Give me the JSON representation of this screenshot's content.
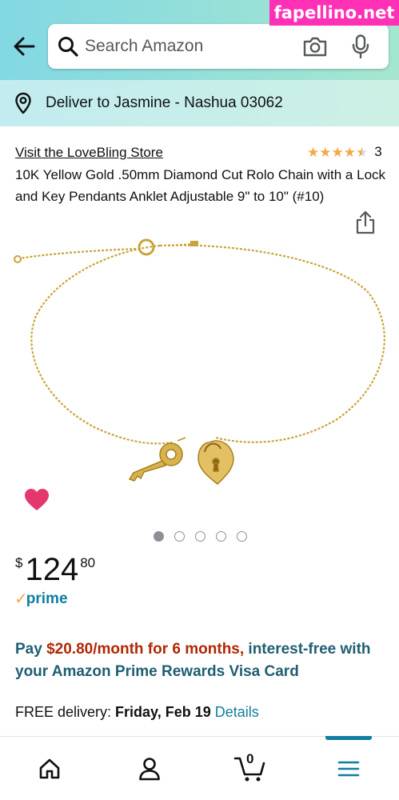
{
  "watermark": "fapellino.net",
  "search": {
    "placeholder": "Search Amazon"
  },
  "delivery_bar": {
    "text": "Deliver to Jasmine - Nashua 03062"
  },
  "product": {
    "store_link": "Visit the LoveBling Store",
    "rating_value": 4.5,
    "rating_count": "3",
    "title": "10K Yellow Gold .50mm Diamond Cut Rolo Chain with a Lock and Key Pendants Anklet Adjustable 9\" to 10\" (#10)",
    "image_count": 5,
    "active_image": 1
  },
  "price": {
    "currency": "$",
    "whole": "124",
    "fraction": "80"
  },
  "prime": {
    "check": "✓",
    "label": "prime"
  },
  "financing": {
    "prefix": "Pay ",
    "amount": "$20.80/month for 6 months,",
    "suffix": " interest-free with your Amazon Prime Rewards Visa Card"
  },
  "delivery": {
    "label": "FREE delivery: ",
    "date": "Friday, Feb 19",
    "details": "Details"
  },
  "bottom_nav": {
    "cart_count": "0"
  },
  "colors": {
    "accent": "#0f7ea0",
    "price_red": "#b12704",
    "star": "#f3a847",
    "heart": "#e4386d",
    "header_start": "#82d8e3",
    "header_end": "#a5e6cf"
  },
  "icons": [
    "back-arrow-icon",
    "search-icon",
    "camera-icon",
    "microphone-icon",
    "location-pin-icon",
    "share-icon",
    "heart-icon",
    "home-icon",
    "account-icon",
    "cart-icon",
    "menu-icon"
  ]
}
